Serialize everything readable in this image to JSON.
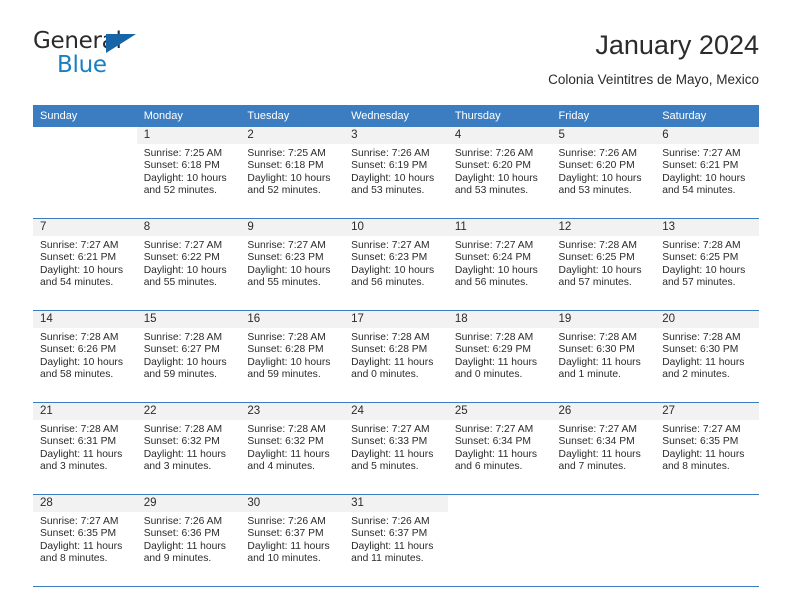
{
  "brand": {
    "name_part1": "General",
    "name_part2": "Blue",
    "flag_icon": "flag-triangle-icon",
    "accent_color": "#1a7fc1"
  },
  "header": {
    "title": "January 2024",
    "subtitle": "Colonia Veintitres de Mayo, Mexico"
  },
  "calendar": {
    "header_bg": "#3b7dc0",
    "daynum_bg": "#f2f2f2",
    "weekday_headers": [
      "Sunday",
      "Monday",
      "Tuesday",
      "Wednesday",
      "Thursday",
      "Friday",
      "Saturday"
    ],
    "weeks": [
      [
        {
          "day": "",
          "lines": []
        },
        {
          "day": "1",
          "lines": [
            "Sunrise: 7:25 AM",
            "Sunset: 6:18 PM",
            "Daylight: 10 hours",
            "and 52 minutes."
          ]
        },
        {
          "day": "2",
          "lines": [
            "Sunrise: 7:25 AM",
            "Sunset: 6:18 PM",
            "Daylight: 10 hours",
            "and 52 minutes."
          ]
        },
        {
          "day": "3",
          "lines": [
            "Sunrise: 7:26 AM",
            "Sunset: 6:19 PM",
            "Daylight: 10 hours",
            "and 53 minutes."
          ]
        },
        {
          "day": "4",
          "lines": [
            "Sunrise: 7:26 AM",
            "Sunset: 6:20 PM",
            "Daylight: 10 hours",
            "and 53 minutes."
          ]
        },
        {
          "day": "5",
          "lines": [
            "Sunrise: 7:26 AM",
            "Sunset: 6:20 PM",
            "Daylight: 10 hours",
            "and 53 minutes."
          ]
        },
        {
          "day": "6",
          "lines": [
            "Sunrise: 7:27 AM",
            "Sunset: 6:21 PM",
            "Daylight: 10 hours",
            "and 54 minutes."
          ]
        }
      ],
      [
        {
          "day": "7",
          "lines": [
            "Sunrise: 7:27 AM",
            "Sunset: 6:21 PM",
            "Daylight: 10 hours",
            "and 54 minutes."
          ]
        },
        {
          "day": "8",
          "lines": [
            "Sunrise: 7:27 AM",
            "Sunset: 6:22 PM",
            "Daylight: 10 hours",
            "and 55 minutes."
          ]
        },
        {
          "day": "9",
          "lines": [
            "Sunrise: 7:27 AM",
            "Sunset: 6:23 PM",
            "Daylight: 10 hours",
            "and 55 minutes."
          ]
        },
        {
          "day": "10",
          "lines": [
            "Sunrise: 7:27 AM",
            "Sunset: 6:23 PM",
            "Daylight: 10 hours",
            "and 56 minutes."
          ]
        },
        {
          "day": "11",
          "lines": [
            "Sunrise: 7:27 AM",
            "Sunset: 6:24 PM",
            "Daylight: 10 hours",
            "and 56 minutes."
          ]
        },
        {
          "day": "12",
          "lines": [
            "Sunrise: 7:28 AM",
            "Sunset: 6:25 PM",
            "Daylight: 10 hours",
            "and 57 minutes."
          ]
        },
        {
          "day": "13",
          "lines": [
            "Sunrise: 7:28 AM",
            "Sunset: 6:25 PM",
            "Daylight: 10 hours",
            "and 57 minutes."
          ]
        }
      ],
      [
        {
          "day": "14",
          "lines": [
            "Sunrise: 7:28 AM",
            "Sunset: 6:26 PM",
            "Daylight: 10 hours",
            "and 58 minutes."
          ]
        },
        {
          "day": "15",
          "lines": [
            "Sunrise: 7:28 AM",
            "Sunset: 6:27 PM",
            "Daylight: 10 hours",
            "and 59 minutes."
          ]
        },
        {
          "day": "16",
          "lines": [
            "Sunrise: 7:28 AM",
            "Sunset: 6:28 PM",
            "Daylight: 10 hours",
            "and 59 minutes."
          ]
        },
        {
          "day": "17",
          "lines": [
            "Sunrise: 7:28 AM",
            "Sunset: 6:28 PM",
            "Daylight: 11 hours",
            "and 0 minutes."
          ]
        },
        {
          "day": "18",
          "lines": [
            "Sunrise: 7:28 AM",
            "Sunset: 6:29 PM",
            "Daylight: 11 hours",
            "and 0 minutes."
          ]
        },
        {
          "day": "19",
          "lines": [
            "Sunrise: 7:28 AM",
            "Sunset: 6:30 PM",
            "Daylight: 11 hours",
            "and 1 minute."
          ]
        },
        {
          "day": "20",
          "lines": [
            "Sunrise: 7:28 AM",
            "Sunset: 6:30 PM",
            "Daylight: 11 hours",
            "and 2 minutes."
          ]
        }
      ],
      [
        {
          "day": "21",
          "lines": [
            "Sunrise: 7:28 AM",
            "Sunset: 6:31 PM",
            "Daylight: 11 hours",
            "and 3 minutes."
          ]
        },
        {
          "day": "22",
          "lines": [
            "Sunrise: 7:28 AM",
            "Sunset: 6:32 PM",
            "Daylight: 11 hours",
            "and 3 minutes."
          ]
        },
        {
          "day": "23",
          "lines": [
            "Sunrise: 7:28 AM",
            "Sunset: 6:32 PM",
            "Daylight: 11 hours",
            "and 4 minutes."
          ]
        },
        {
          "day": "24",
          "lines": [
            "Sunrise: 7:27 AM",
            "Sunset: 6:33 PM",
            "Daylight: 11 hours",
            "and 5 minutes."
          ]
        },
        {
          "day": "25",
          "lines": [
            "Sunrise: 7:27 AM",
            "Sunset: 6:34 PM",
            "Daylight: 11 hours",
            "and 6 minutes."
          ]
        },
        {
          "day": "26",
          "lines": [
            "Sunrise: 7:27 AM",
            "Sunset: 6:34 PM",
            "Daylight: 11 hours",
            "and 7 minutes."
          ]
        },
        {
          "day": "27",
          "lines": [
            "Sunrise: 7:27 AM",
            "Sunset: 6:35 PM",
            "Daylight: 11 hours",
            "and 8 minutes."
          ]
        }
      ],
      [
        {
          "day": "28",
          "lines": [
            "Sunrise: 7:27 AM",
            "Sunset: 6:35 PM",
            "Daylight: 11 hours",
            "and 8 minutes."
          ]
        },
        {
          "day": "29",
          "lines": [
            "Sunrise: 7:26 AM",
            "Sunset: 6:36 PM",
            "Daylight: 11 hours",
            "and 9 minutes."
          ]
        },
        {
          "day": "30",
          "lines": [
            "Sunrise: 7:26 AM",
            "Sunset: 6:37 PM",
            "Daylight: 11 hours",
            "and 10 minutes."
          ]
        },
        {
          "day": "31",
          "lines": [
            "Sunrise: 7:26 AM",
            "Sunset: 6:37 PM",
            "Daylight: 11 hours",
            "and 11 minutes."
          ]
        },
        {
          "day": "",
          "lines": []
        },
        {
          "day": "",
          "lines": []
        },
        {
          "day": "",
          "lines": []
        }
      ]
    ]
  }
}
